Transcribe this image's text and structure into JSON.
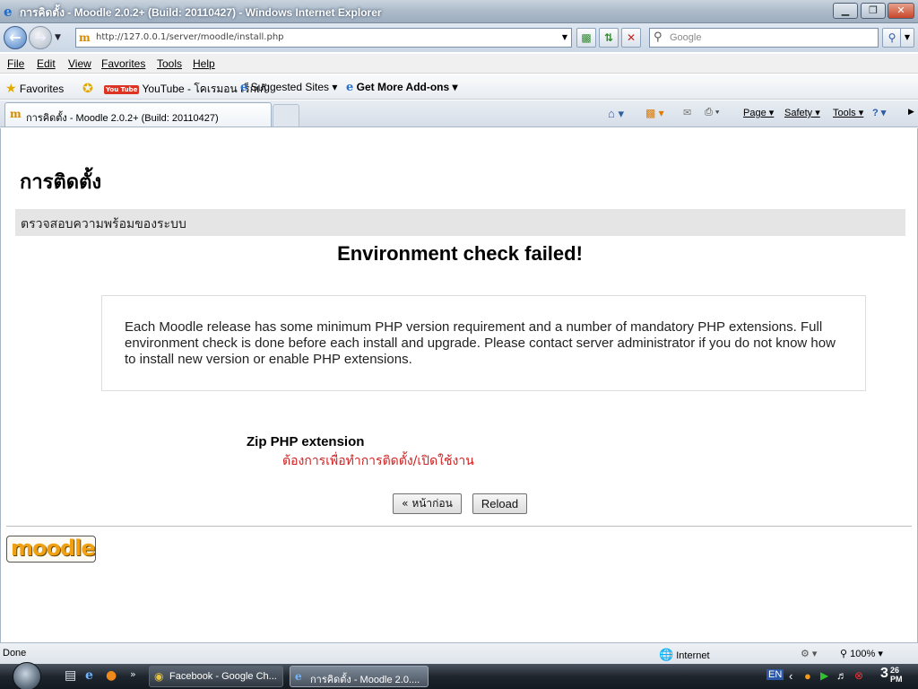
{
  "window": {
    "title": "การคิดตั้ง - Moodle 2.0.2+ (Build: 20110427) - Windows Internet Explorer",
    "minimize_glyph": "▁",
    "maximize_glyph": "❐",
    "close_glyph": "✕"
  },
  "nav": {
    "url": "http://127.0.0.1/server/moodle/install.php",
    "search_placeholder": "Google"
  },
  "menu": {
    "items": [
      "File",
      "Edit",
      "View",
      "Favorites",
      "Tools",
      "Help"
    ]
  },
  "favorites_bar": {
    "favorites_label": "Favorites",
    "youtube_badge": "You Tube",
    "items": [
      "YouTube - โคเรมอน เร็กเก้",
      "Suggested Sites ▾",
      "Get More Add-ons ▾"
    ]
  },
  "tabs": {
    "active_label": "การคิดตั้ง - Moodle 2.0.2+ (Build: 20110427)"
  },
  "command_bar": {
    "page": "Page ▾",
    "safety": "Safety ▾",
    "tools": "Tools ▾"
  },
  "page": {
    "heading": "การติดตั้ง",
    "step_title": "ตรวจสอบความพร้อมของระบบ",
    "error_title": "Environment check failed!",
    "info_text": "Each Moodle release has some minimum PHP version requirement and a number of mandatory PHP extensions. Full environment check is done before each install and upgrade. Please contact server administrator if you do not know how to install new version or enable PHP extensions.",
    "requirement_name": "Zip PHP extension",
    "requirement_status": "ต้องการเพื่อทำการติดตั้ง/เปิดใช้งาน",
    "prev_button": "« หน้าก่อน",
    "reload_button": "Reload",
    "logo_text": "moodle"
  },
  "status_bar": {
    "status": "Done",
    "zone": "Internet",
    "zoom": "100%"
  },
  "taskbar": {
    "items": [
      "Facebook - Google Ch...",
      "การคิดตั้ง - Moodle 2.0...."
    ],
    "language": "EN",
    "clock_time": "3",
    "clock_minutes": "26",
    "clock_ampm": "PM"
  },
  "colors": {
    "error_text": "#d02020",
    "moodle_orange": "#f0a010",
    "step_bar": "#e5e5e5"
  }
}
